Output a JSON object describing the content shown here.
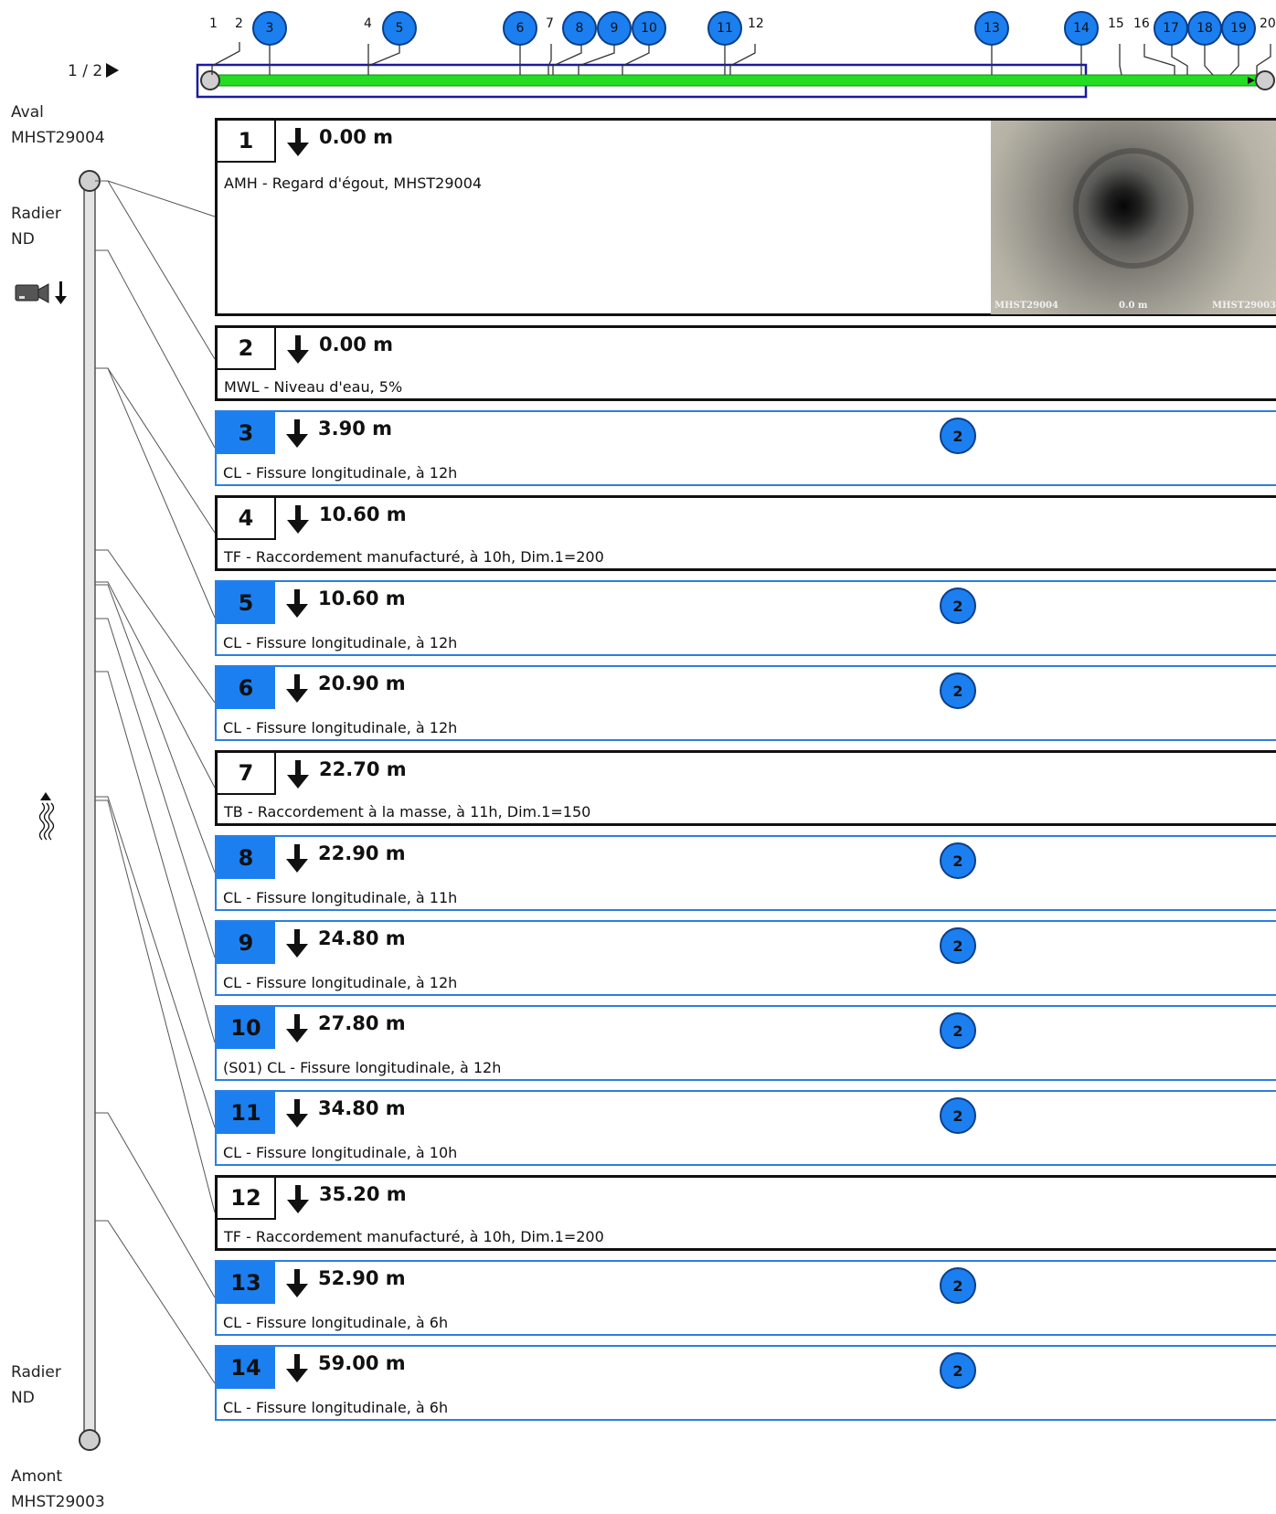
{
  "page_indicator": "1 / 2",
  "left_panel": {
    "aval_label": "Aval",
    "aval_id": "MHST29004",
    "radier_top": "Radier",
    "nd_top": "ND",
    "radier_bottom": "Radier",
    "nd_bottom": "ND",
    "amont_label": "Amont",
    "amont_id": "MHST29003"
  },
  "top_markers": [
    {
      "n": "1",
      "style": "text"
    },
    {
      "n": "2",
      "style": "text"
    },
    {
      "n": "3",
      "style": "circle"
    },
    {
      "n": "4",
      "style": "text"
    },
    {
      "n": "5",
      "style": "circle"
    },
    {
      "n": "6",
      "style": "circle"
    },
    {
      "n": "7",
      "style": "text"
    },
    {
      "n": "8",
      "style": "circle"
    },
    {
      "n": "9",
      "style": "circle"
    },
    {
      "n": "10",
      "style": "circle"
    },
    {
      "n": "11",
      "style": "circle"
    },
    {
      "n": "12",
      "style": "text"
    },
    {
      "n": "13",
      "style": "circle"
    },
    {
      "n": "14",
      "style": "circle"
    },
    {
      "n": "15",
      "style": "text"
    },
    {
      "n": "16",
      "style": "text"
    },
    {
      "n": "17",
      "style": "circle"
    },
    {
      "n": "18",
      "style": "circle"
    },
    {
      "n": "19",
      "style": "circle"
    },
    {
      "n": "20",
      "style": "text"
    }
  ],
  "photo_caption": {
    "left": "MHST29004",
    "center": "0.0 m",
    "right": "MHST29003"
  },
  "observations": [
    {
      "num": "1",
      "dist": "0.00 m",
      "desc": "AMH - Regard d'égout, MHST29004",
      "style": "plain",
      "grade": ""
    },
    {
      "num": "2",
      "dist": "0.00 m",
      "desc": "MWL - Niveau d'eau, 5%",
      "style": "plain",
      "grade": ""
    },
    {
      "num": "3",
      "dist": "3.90 m",
      "desc": "CL - Fissure longitudinale, à 12h",
      "style": "blue",
      "grade": "2"
    },
    {
      "num": "4",
      "dist": "10.60 m",
      "desc": "TF - Raccordement manufacturé, à 10h, Dim.1=200",
      "style": "plain",
      "grade": ""
    },
    {
      "num": "5",
      "dist": "10.60 m",
      "desc": "CL - Fissure longitudinale, à 12h",
      "style": "blue",
      "grade": "2"
    },
    {
      "num": "6",
      "dist": "20.90 m",
      "desc": "CL - Fissure longitudinale, à 12h",
      "style": "blue",
      "grade": "2"
    },
    {
      "num": "7",
      "dist": "22.70 m",
      "desc": "TB - Raccordement à la masse, à 11h, Dim.1=150",
      "style": "plain",
      "grade": ""
    },
    {
      "num": "8",
      "dist": "22.90 m",
      "desc": "CL - Fissure longitudinale, à 11h",
      "style": "blue",
      "grade": "2"
    },
    {
      "num": "9",
      "dist": "24.80 m",
      "desc": "CL - Fissure longitudinale, à 12h",
      "style": "blue",
      "grade": "2"
    },
    {
      "num": "10",
      "dist": "27.80 m",
      "desc": "(S01) CL - Fissure longitudinale, à 12h",
      "style": "blue",
      "grade": "2"
    },
    {
      "num": "11",
      "dist": "34.80 m",
      "desc": "CL - Fissure longitudinale, à 10h",
      "style": "blue",
      "grade": "2"
    },
    {
      "num": "12",
      "dist": "35.20 m",
      "desc": "TF - Raccordement manufacturé, à 10h, Dim.1=200",
      "style": "plain",
      "grade": ""
    },
    {
      "num": "13",
      "dist": "52.90 m",
      "desc": "CL - Fissure longitudinale, à 6h",
      "style": "blue",
      "grade": "2"
    },
    {
      "num": "14",
      "dist": "59.00 m",
      "desc": "CL - Fissure longitudinale, à 6h",
      "style": "blue",
      "grade": "2"
    }
  ],
  "icons": {
    "camera": "camera-icon",
    "down_arrow": "down-arrow-icon",
    "flow": "flow-direction-icon"
  },
  "colors": {
    "accent_blue": "#1c7ff0",
    "pipe_green": "#22dd22",
    "frame_navy": "#1a1aa0"
  }
}
